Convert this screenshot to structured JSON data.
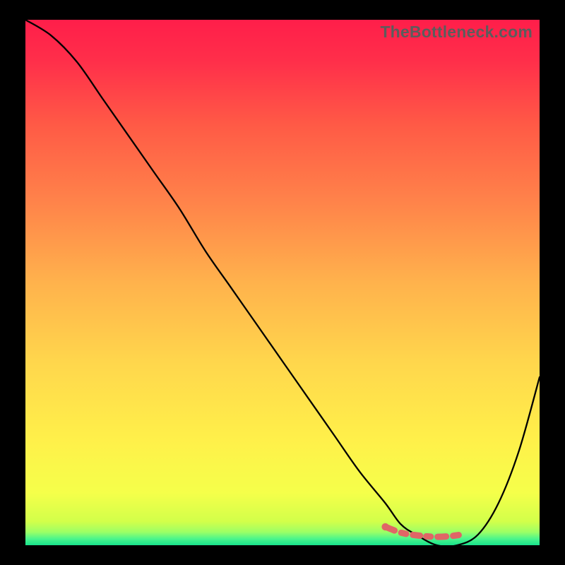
{
  "watermark": "TheBottleneck.com",
  "chart_data": {
    "type": "line",
    "title": "",
    "xlabel": "",
    "ylabel": "",
    "xlim": [
      0,
      100
    ],
    "ylim": [
      0,
      100
    ],
    "series": [
      {
        "name": "bottleneck-curve",
        "x": [
          0,
          5,
          10,
          15,
          20,
          25,
          30,
          35,
          40,
          45,
          50,
          55,
          60,
          65,
          70,
          73,
          76,
          80,
          84,
          88,
          92,
          96,
          100
        ],
        "y": [
          100,
          97,
          92,
          85,
          78,
          71,
          64,
          56,
          49,
          42,
          35,
          28,
          21,
          14,
          8,
          4,
          2,
          0,
          0,
          2,
          8,
          18,
          32
        ]
      },
      {
        "name": "green-band",
        "x": [
          70,
          73,
          76,
          80,
          84,
          88
        ],
        "y": [
          3.5,
          2.4,
          1.9,
          1.6,
          1.9,
          2.8
        ]
      }
    ],
    "gradient_stops": [
      {
        "offset": 0,
        "color": "#ff1e4a"
      },
      {
        "offset": 0.08,
        "color": "#ff2f4a"
      },
      {
        "offset": 0.2,
        "color": "#ff5a46"
      },
      {
        "offset": 0.35,
        "color": "#ff844a"
      },
      {
        "offset": 0.5,
        "color": "#ffb24c"
      },
      {
        "offset": 0.65,
        "color": "#ffd64c"
      },
      {
        "offset": 0.8,
        "color": "#fff04a"
      },
      {
        "offset": 0.9,
        "color": "#f5ff4a"
      },
      {
        "offset": 0.955,
        "color": "#d2ff4a"
      },
      {
        "offset": 0.975,
        "color": "#9cff66"
      },
      {
        "offset": 0.988,
        "color": "#4af58c"
      },
      {
        "offset": 1.0,
        "color": "#18e28c"
      }
    ],
    "colors": {
      "curve": "#000000",
      "band": "#e06666"
    }
  }
}
